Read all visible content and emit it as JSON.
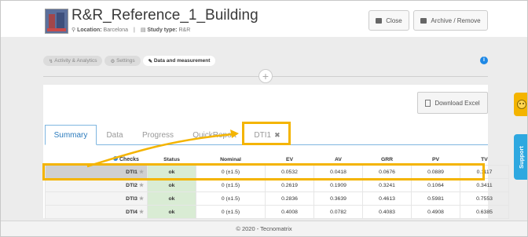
{
  "header": {
    "title": "R&R_Reference_1_Building",
    "location_label": "Location:",
    "location_value": "Barcelona",
    "study_type_label": "Study type:",
    "study_type_value": "R&R",
    "close_label": "Close",
    "archive_label": "Archive / Remove"
  },
  "nav_tabs": [
    {
      "label": "Activity & Analytics"
    },
    {
      "label": "Settings"
    },
    {
      "label": "Data and measurement"
    }
  ],
  "download_excel_label": "Download Excel",
  "view_tabs": {
    "summary": "Summary",
    "data": "Data",
    "progress": "Progress",
    "quickreport": "QuickReport",
    "dti1": "DTI1",
    "close_glyph": "✖"
  },
  "table": {
    "checks_label": "Checks",
    "columns": [
      "Status",
      "Nominal",
      "EV",
      "AV",
      "GRR",
      "PV",
      "TV"
    ],
    "rows": [
      {
        "name": "DTI1",
        "status": "ok",
        "nominal": "0 (±1.5)",
        "ev": "0.0532",
        "av": "0.0418",
        "grr": "0.0676",
        "pv": "0.0889",
        "tv": "0.1117"
      },
      {
        "name": "DTI2",
        "status": "ok",
        "nominal": "0 (±1.5)",
        "ev": "0.2619",
        "av": "0.1909",
        "grr": "0.3241",
        "pv": "0.1064",
        "tv": "0.3411"
      },
      {
        "name": "DTI3",
        "status": "ok",
        "nominal": "0 (±1.5)",
        "ev": "0.2836",
        "av": "0.3639",
        "grr": "0.4613",
        "pv": "0.5981",
        "tv": "0.7553"
      },
      {
        "name": "DTI4",
        "status": "ok",
        "nominal": "0 (±1.5)",
        "ev": "0.4008",
        "av": "0.0782",
        "grr": "0.4083",
        "pv": "0.4908",
        "tv": "0.6385"
      }
    ]
  },
  "footer_text": "© 2020 - Tecnomatrix",
  "side": {
    "support_label": "Support"
  },
  "colors": {
    "highlight": "#f4b400",
    "accent": "#2b7bbd",
    "status_ok_bg": "#d9ecd4"
  }
}
